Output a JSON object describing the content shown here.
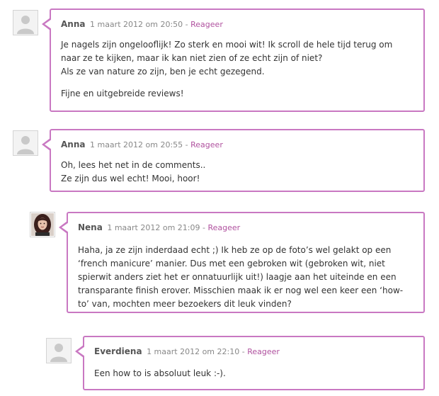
{
  "theme": {
    "border": "#c978c2",
    "reply_link": "#b0529f"
  },
  "comments": [
    {
      "author": "Anna",
      "date": "1 maart 2012 om 20:50",
      "separator": "-",
      "reply_label": "Reageer",
      "avatar": "default-avatar-icon",
      "lines": [
        "Je nagels zijn ongelooflijk! Zo sterk en mooi wit! Ik scroll de hele tijd terug om",
        "naar ze te kijken, maar ik kan niet zien of ze echt zijn of niet?",
        "Als ze van nature zo zijn, ben je echt gezegend."
      ],
      "paragraph2": "Fijne en uitgebreide reviews!"
    },
    {
      "author": "Anna",
      "date": "1 maart 2012 om 20:55",
      "separator": "-",
      "reply_label": "Reageer",
      "avatar": "default-avatar-icon",
      "lines": [
        "Oh, lees het net in de comments..",
        "Ze zijn dus wel echt! Mooi, hoor!"
      ]
    },
    {
      "author": "Nena",
      "date": "1 maart 2012 om 21:09",
      "separator": "-",
      "reply_label": "Reageer",
      "avatar": "profile-photo",
      "lines": [
        "Haha, ja ze zijn inderdaad echt ;) Ik heb ze op de foto’s wel gelakt op een",
        "‘french manicure’ manier. Dus met een gebroken wit (gebroken wit, niet",
        "spierwit anders ziet het er onnatuurlijk uit!) laagje aan het uiteinde en een",
        "transparante finish erover. Misschien maak ik er nog wel een keer een ‘how-",
        "to’ van, mochten meer bezoekers dit leuk vinden?"
      ]
    },
    {
      "author": "Everdiena",
      "date": "1 maart 2012 om 22:10",
      "separator": "-",
      "reply_label": "Reageer",
      "avatar": "default-avatar-icon",
      "lines": [
        "Een how to is absoluut leuk :-)."
      ]
    }
  ]
}
